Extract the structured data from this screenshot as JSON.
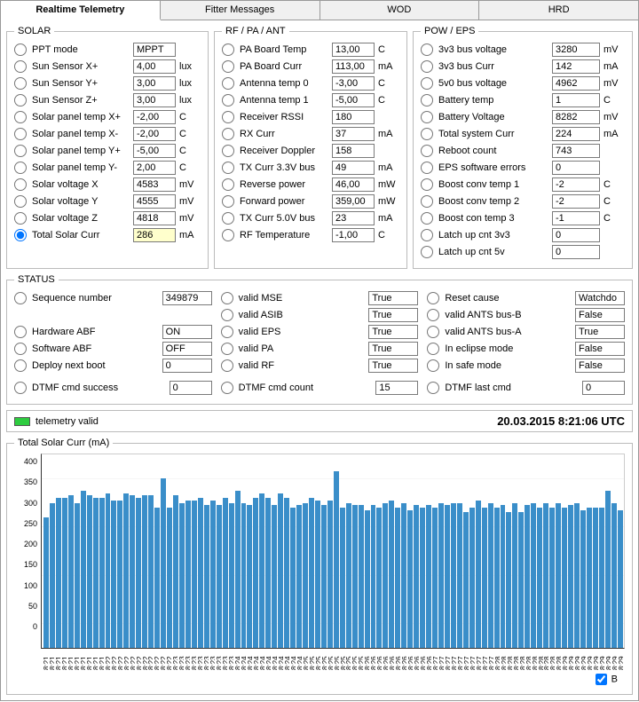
{
  "tabs": [
    "Realtime Telemetry",
    "Fitter Messages",
    "WOD",
    "HRD"
  ],
  "active_tab": 0,
  "solar": {
    "legend": "SOLAR",
    "rows": [
      {
        "label": "PPT mode",
        "value": "MPPT",
        "unit": ""
      },
      {
        "label": "Sun Sensor X+",
        "value": "4,00",
        "unit": "lux"
      },
      {
        "label": "Sun Sensor Y+",
        "value": "3,00",
        "unit": "lux"
      },
      {
        "label": "Sun Sensor Z+",
        "value": "3,00",
        "unit": "lux"
      },
      {
        "label": "Solar panel temp X+",
        "value": "-2,00",
        "unit": "C"
      },
      {
        "label": "Solar panel temp X-",
        "value": "-2,00",
        "unit": "C"
      },
      {
        "label": "Solar panel temp Y+",
        "value": "-5,00",
        "unit": "C"
      },
      {
        "label": "Solar panel temp Y-",
        "value": "2,00",
        "unit": "C"
      },
      {
        "label": "Solar voltage X",
        "value": "4583",
        "unit": "mV"
      },
      {
        "label": "Solar voltage Y",
        "value": "4555",
        "unit": "mV"
      },
      {
        "label": "Solar voltage Z",
        "value": "4818",
        "unit": "mV"
      },
      {
        "label": "Total Solar Curr",
        "value": "286",
        "unit": "mA",
        "selected": true,
        "hl": true
      }
    ]
  },
  "rf": {
    "legend": "RF / PA / ANT",
    "rows": [
      {
        "label": "PA Board Temp",
        "value": "13,00",
        "unit": "C"
      },
      {
        "label": "PA Board Curr",
        "value": "113,00",
        "unit": "mA"
      },
      {
        "label": "Antenna temp 0",
        "value": "-3,00",
        "unit": "C"
      },
      {
        "label": "Antenna temp 1",
        "value": "-5,00",
        "unit": "C"
      },
      {
        "label": "Receiver RSSI",
        "value": "180",
        "unit": ""
      },
      {
        "label": "RX Curr",
        "value": "37",
        "unit": "mA"
      },
      {
        "label": "Receiver Doppler",
        "value": "158",
        "unit": ""
      },
      {
        "label": "TX Curr 3.3V bus",
        "value": "49",
        "unit": "mA"
      },
      {
        "label": "Reverse power",
        "value": "46,00",
        "unit": "mW"
      },
      {
        "label": "Forward power",
        "value": "359,00",
        "unit": "mW"
      },
      {
        "label": "TX Curr 5.0V bus",
        "value": "23",
        "unit": "mA"
      },
      {
        "label": "RF Temperature",
        "value": "-1,00",
        "unit": "C"
      }
    ]
  },
  "pow": {
    "legend": "POW / EPS",
    "rows": [
      {
        "label": "3v3 bus voltage",
        "value": "3280",
        "unit": "mV"
      },
      {
        "label": "3v3 bus Curr",
        "value": "142",
        "unit": "mA"
      },
      {
        "label": "5v0 bus voltage",
        "value": "4962",
        "unit": "mV"
      },
      {
        "label": "Battery temp",
        "value": "1",
        "unit": "C"
      },
      {
        "label": "Battery Voltage",
        "value": "8282",
        "unit": "mV"
      },
      {
        "label": "Total system Curr",
        "value": "224",
        "unit": "mA"
      },
      {
        "label": "Reboot count",
        "value": "743",
        "unit": ""
      },
      {
        "label": "EPS software errors",
        "value": "0",
        "unit": ""
      },
      {
        "label": "Boost conv temp 1",
        "value": "-2",
        "unit": "C"
      },
      {
        "label": "Boost conv temp 2",
        "value": "-2",
        "unit": "C"
      },
      {
        "label": "Boost con temp 3",
        "value": "-1",
        "unit": "C"
      },
      {
        "label": "Latch up cnt 3v3",
        "value": "0",
        "unit": ""
      },
      {
        "label": "Latch up cnt 5v",
        "value": "0",
        "unit": ""
      }
    ]
  },
  "status": {
    "legend": "STATUS",
    "col1": [
      {
        "label": "Sequence number",
        "value": "349879"
      },
      {
        "label": "",
        "value": ""
      },
      {
        "label": "Hardware ABF",
        "value": "ON"
      },
      {
        "label": "Software ABF",
        "value": "OFF"
      },
      {
        "label": "Deploy next boot",
        "value": "0"
      }
    ],
    "col2": [
      {
        "label": "valid MSE",
        "value": "True"
      },
      {
        "label": "valid ASIB",
        "value": "True"
      },
      {
        "label": "valid EPS",
        "value": "True"
      },
      {
        "label": "valid PA",
        "value": "True"
      },
      {
        "label": "valid RF",
        "value": "True"
      }
    ],
    "col3": [
      {
        "label": "Reset cause",
        "value": "Watchdo"
      },
      {
        "label": "valid ANTS bus-B",
        "value": "False"
      },
      {
        "label": "valid ANTS bus-A",
        "value": "True"
      },
      {
        "label": "In eclipse mode",
        "value": "False"
      },
      {
        "label": "In safe mode",
        "value": "False"
      }
    ],
    "bottom": [
      {
        "label": "DTMF cmd success",
        "value": "0"
      },
      {
        "label": "DTMF cmd count",
        "value": "15"
      },
      {
        "label": "DTMF last cmd",
        "value": "0"
      }
    ]
  },
  "telemetry_valid": {
    "label": "telemetry valid",
    "timestamp": "20.03.2015 8:21:06 UTC"
  },
  "chart_data": {
    "type": "bar",
    "title": "Total Solar Curr (mA)",
    "ylabel": "",
    "xlabel": "",
    "ylim": [
      0,
      400
    ],
    "yticks": [
      0,
      50,
      100,
      150,
      200,
      250,
      300,
      350,
      400
    ],
    "categories": [
      "8:21",
      "8:21",
      "8:21",
      "8:21",
      "8:21",
      "8:21",
      "8:21",
      "8:21",
      "8:21",
      "8:21",
      "8:22",
      "8:22",
      "8:22",
      "8:22",
      "8:22",
      "8:22",
      "8:22",
      "8:22",
      "8:22",
      "8:22",
      "8:22",
      "8:23",
      "8:23",
      "8:23",
      "8:23",
      "8:23",
      "8:23",
      "8:23",
      "8:23",
      "8:23",
      "8:23",
      "8:24",
      "8:24",
      "8:24",
      "8:24",
      "8:24",
      "8:24",
      "8:24",
      "8:24",
      "8:24",
      "8:24",
      "8:24",
      "8:25",
      "8:25",
      "8:25",
      "8:25",
      "8:25",
      "8:25",
      "8:25",
      "8:25",
      "8:25",
      "8:25",
      "8:26",
      "8:26",
      "8:26",
      "8:26",
      "8:26",
      "8:26",
      "8:26",
      "8:26",
      "8:26",
      "8:26",
      "8:26",
      "8:27",
      "8:27",
      "8:27",
      "8:27",
      "8:27",
      "8:27",
      "8:27",
      "8:27",
      "8:27",
      "8:27",
      "8:28",
      "8:28",
      "8:28",
      "8:28",
      "8:28",
      "8:28",
      "8:28",
      "8:28",
      "8:28",
      "8:28",
      "8:28",
      "8:29",
      "8:29",
      "8:29",
      "8:29",
      "8:29",
      "8:29",
      "8:29",
      "8:29",
      "8:29",
      "8:29"
    ],
    "values": [
      270,
      300,
      310,
      310,
      315,
      300,
      325,
      315,
      310,
      310,
      320,
      305,
      305,
      320,
      315,
      310,
      315,
      315,
      290,
      350,
      290,
      315,
      300,
      305,
      305,
      310,
      295,
      305,
      295,
      310,
      300,
      325,
      300,
      295,
      310,
      320,
      310,
      295,
      320,
      310,
      290,
      295,
      300,
      310,
      305,
      295,
      305,
      365,
      290,
      300,
      295,
      295,
      285,
      295,
      290,
      300,
      305,
      290,
      300,
      285,
      295,
      290,
      295,
      290,
      300,
      295,
      300,
      300,
      280,
      290,
      305,
      290,
      300,
      290,
      295,
      280,
      300,
      280,
      295,
      300,
      290,
      300,
      290,
      300,
      290,
      295,
      300,
      285,
      290,
      290,
      290,
      325,
      300,
      285
    ]
  },
  "checkbox_b": {
    "label": "B",
    "checked": true
  }
}
